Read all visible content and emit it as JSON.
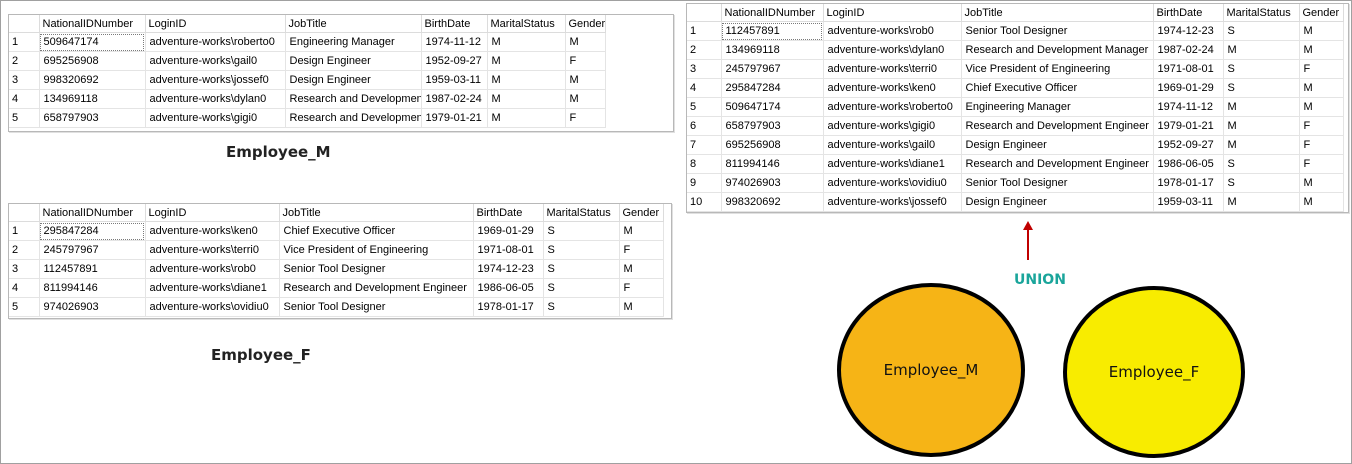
{
  "columns": [
    "",
    "NationalIDNumber",
    "LoginID",
    "JobTitle",
    "BirthDate",
    "MaritalStatus",
    "Gender"
  ],
  "employee_m": {
    "caption": "Employee_M",
    "rows": [
      [
        "1",
        "509647174",
        "adventure-works\\roberto0",
        "Engineering Manager",
        "1974-11-12",
        "M",
        "M"
      ],
      [
        "2",
        "695256908",
        "adventure-works\\gail0",
        "Design Engineer",
        "1952-09-27",
        "M",
        "F"
      ],
      [
        "3",
        "998320692",
        "adventure-works\\jossef0",
        "Design Engineer",
        "1959-03-11",
        "M",
        "M"
      ],
      [
        "4",
        "134969118",
        "adventure-works\\dylan0",
        "Research and Development Manager",
        "1987-02-24",
        "M",
        "M"
      ],
      [
        "5",
        "658797903",
        "adventure-works\\gigi0",
        "Research and Development Engineer",
        "1979-01-21",
        "M",
        "F"
      ]
    ]
  },
  "employee_f": {
    "caption": "Employee_F",
    "rows": [
      [
        "1",
        "295847284",
        "adventure-works\\ken0",
        "Chief Executive Officer",
        "1969-01-29",
        "S",
        "M"
      ],
      [
        "2",
        "245797967",
        "adventure-works\\terri0",
        "Vice President of Engineering",
        "1971-08-01",
        "S",
        "F"
      ],
      [
        "3",
        "112457891",
        "adventure-works\\rob0",
        "Senior Tool Designer",
        "1974-12-23",
        "S",
        "M"
      ],
      [
        "4",
        "811994146",
        "adventure-works\\diane1",
        "Research and Development Engineer",
        "1986-06-05",
        "S",
        "F"
      ],
      [
        "5",
        "974026903",
        "adventure-works\\ovidiu0",
        "Senior Tool Designer",
        "1978-01-17",
        "S",
        "M"
      ]
    ]
  },
  "union_result": {
    "rows": [
      [
        "1",
        "112457891",
        "adventure-works\\rob0",
        "Senior Tool Designer",
        "1974-12-23",
        "S",
        "M"
      ],
      [
        "2",
        "134969118",
        "adventure-works\\dylan0",
        "Research and Development Manager",
        "1987-02-24",
        "M",
        "M"
      ],
      [
        "3",
        "245797967",
        "adventure-works\\terri0",
        "Vice President of Engineering",
        "1971-08-01",
        "S",
        "F"
      ],
      [
        "4",
        "295847284",
        "adventure-works\\ken0",
        "Chief Executive Officer",
        "1969-01-29",
        "S",
        "M"
      ],
      [
        "5",
        "509647174",
        "adventure-works\\roberto0",
        "Engineering Manager",
        "1974-11-12",
        "M",
        "M"
      ],
      [
        "6",
        "658797903",
        "adventure-works\\gigi0",
        "Research and Development Engineer",
        "1979-01-21",
        "M",
        "F"
      ],
      [
        "7",
        "695256908",
        "adventure-works\\gail0",
        "Design Engineer",
        "1952-09-27",
        "M",
        "F"
      ],
      [
        "8",
        "811994146",
        "adventure-works\\diane1",
        "Research and Development Engineer",
        "1986-06-05",
        "S",
        "F"
      ],
      [
        "9",
        "974026903",
        "adventure-works\\ovidiu0",
        "Senior Tool Designer",
        "1978-01-17",
        "S",
        "M"
      ],
      [
        "10",
        "998320692",
        "adventure-works\\jossef0",
        "Design Engineer",
        "1959-03-11",
        "M",
        "M"
      ]
    ]
  },
  "diagram": {
    "operation_label": "UNION",
    "circle_m_label": "Employee_M",
    "circle_f_label": "Employee_F",
    "colors": {
      "circle_m_fill": "#f6b416",
      "circle_f_fill": "#f8ec00",
      "arrow": "#c00000",
      "union_text": "#1aa59b"
    }
  }
}
